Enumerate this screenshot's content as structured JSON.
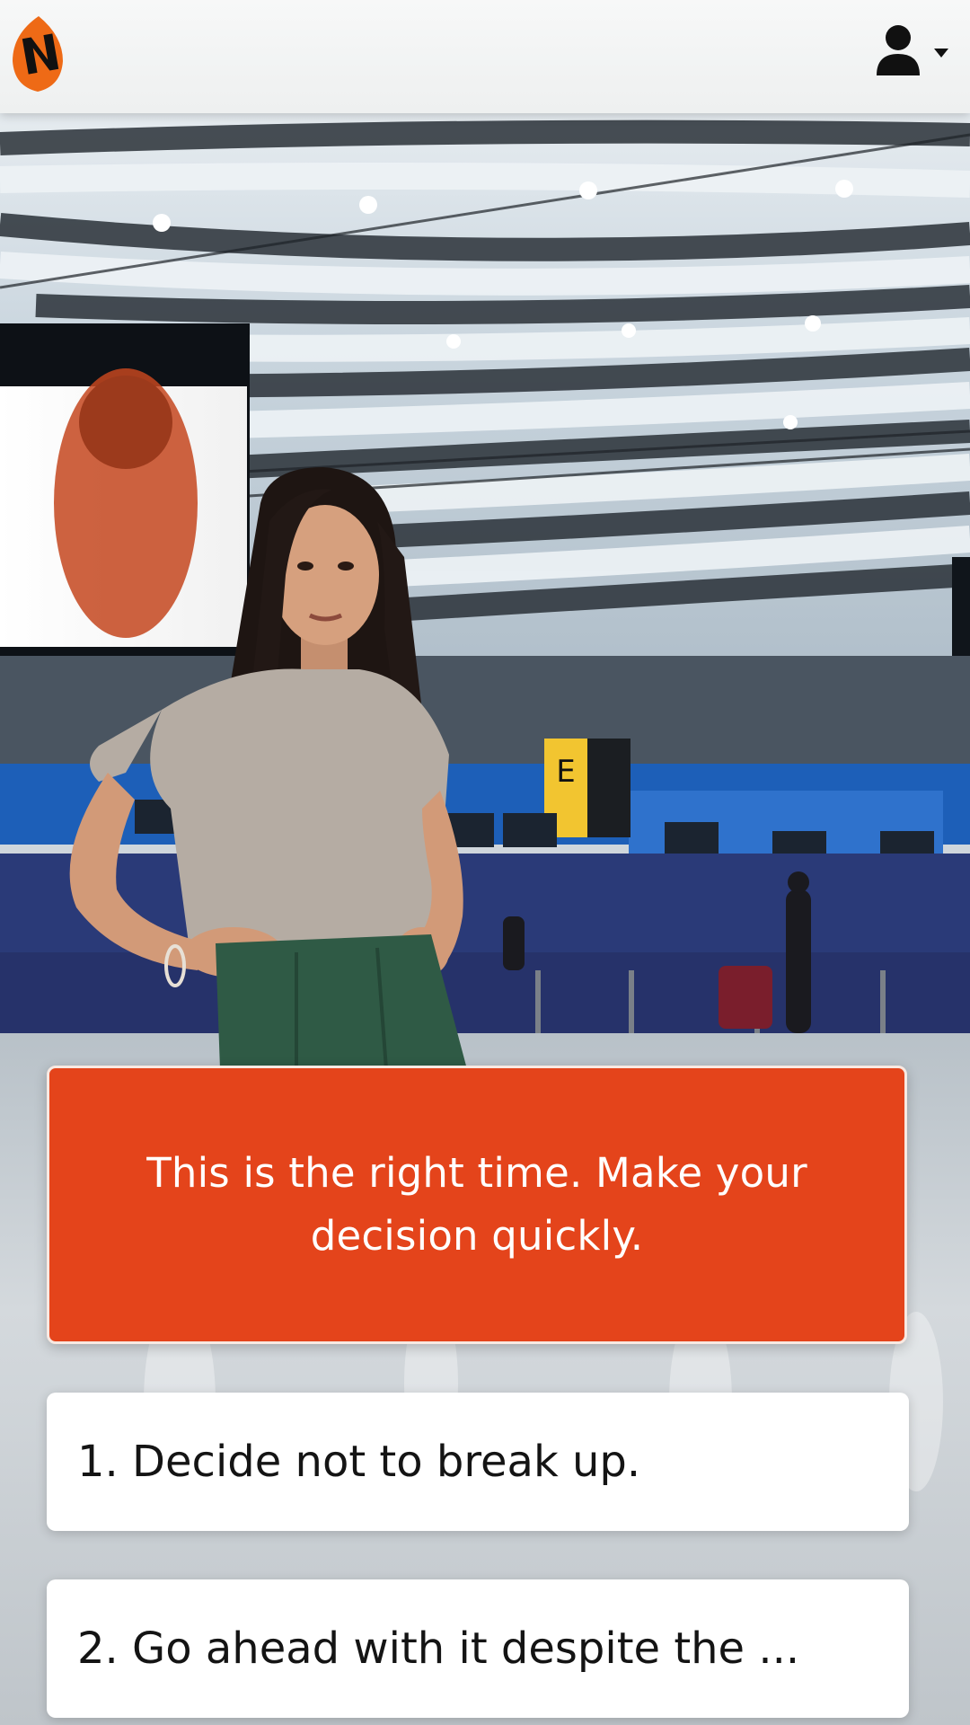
{
  "header": {
    "logo_icon": "n-brand-logo",
    "profile_icon": "user-icon",
    "profile_caret_icon": "caret-down-icon"
  },
  "scene": {
    "description_icon": "airport-terminal-background",
    "character": "woman-standing-character",
    "sign_letter": "E"
  },
  "dialogue": {
    "text": "This is the right time. Make your decision quickly.",
    "background_color": "#e4441b"
  },
  "options": [
    {
      "label": "1. Decide not to break up."
    },
    {
      "label": "2. Go ahead with it despite the ..."
    }
  ]
}
